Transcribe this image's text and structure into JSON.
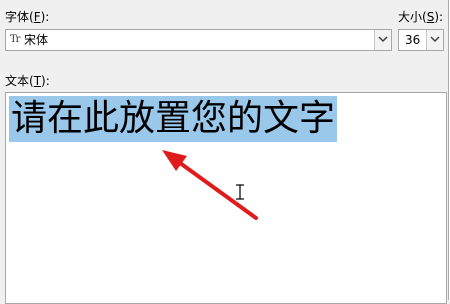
{
  "font_label": {
    "text": "字体(",
    "accel": "F",
    "end": "):"
  },
  "font_select": {
    "preview_glyph": "Tr",
    "value": "宋体"
  },
  "size_label": {
    "text": "大小(",
    "accel": "S",
    "end": "):"
  },
  "size_select": {
    "value": "36"
  },
  "text_label": {
    "text": "文本(",
    "accel": "T",
    "end": "):"
  },
  "text_area": {
    "value": "请在此放置您的文字"
  },
  "annotation": {
    "arrow_color": "#e01b1b"
  },
  "selection_color": "#99c8ea"
}
